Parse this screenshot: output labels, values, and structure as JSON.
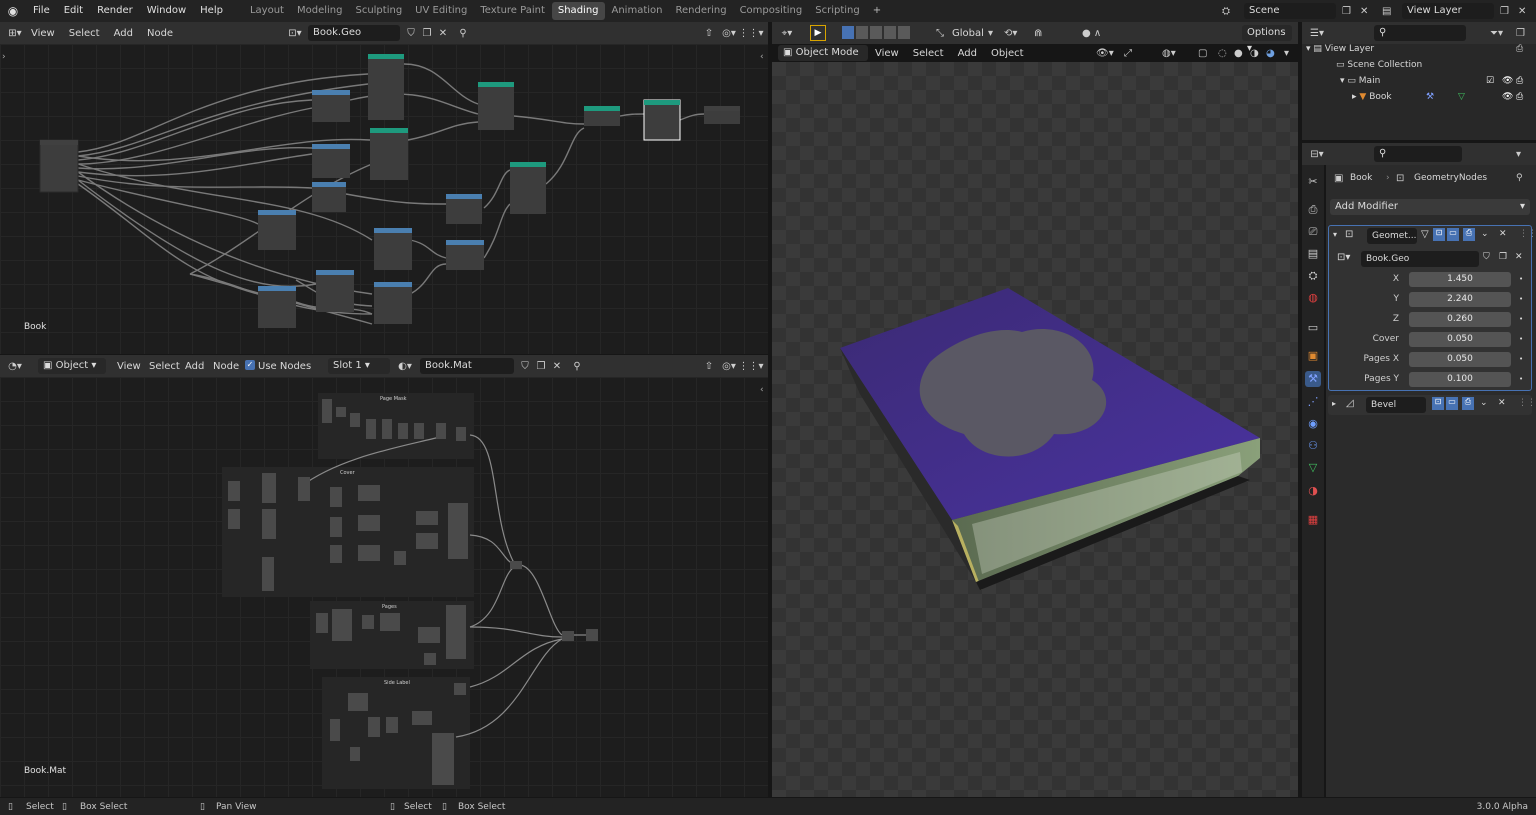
{
  "menu": {
    "items": [
      "File",
      "Edit",
      "Render",
      "Window",
      "Help"
    ]
  },
  "workspaces": [
    "Layout",
    "Modeling",
    "Sculpting",
    "UV Editing",
    "Texture Paint",
    "Shading",
    "Animation",
    "Rendering",
    "Compositing",
    "Scripting"
  ],
  "active_workspace": "Shading",
  "scene": {
    "name": "Scene",
    "view_layer": "View Layer"
  },
  "geo_editor": {
    "menus": [
      "View",
      "Select",
      "Add",
      "Node"
    ],
    "tree_name": "Book.Geo",
    "object_label": "Book"
  },
  "shader_editor": {
    "object_type": "Object",
    "menus": [
      "View",
      "Select",
      "Add",
      "Node"
    ],
    "use_nodes_label": "Use Nodes",
    "slot": "Slot 1",
    "material": "Book.Mat",
    "frames": [
      "Page Mask",
      "Cover",
      "Pages",
      "Side Label"
    ],
    "label": "Book.Mat"
  },
  "viewport": {
    "mode": "Object Mode",
    "menus": [
      "View",
      "Select",
      "Add",
      "Object"
    ],
    "transform": "Global",
    "options_label": "Options"
  },
  "outliner": {
    "view_layer": "View Layer",
    "scene_collection": "Scene Collection",
    "collection": "Main",
    "object": "Book"
  },
  "properties": {
    "object": "Book",
    "modifier_tree": "GeometryNodes",
    "add_modifier": "Add Modifier",
    "mod1_name": "Geomet...",
    "mod1_tree": "Book.Geo",
    "inputs": [
      {
        "label": "X",
        "value": "1.450"
      },
      {
        "label": "Y",
        "value": "2.240"
      },
      {
        "label": "Z",
        "value": "0.260"
      },
      {
        "label": "Cover",
        "value": "0.050"
      },
      {
        "label": "Pages X",
        "value": "0.050"
      },
      {
        "label": "Pages Y",
        "value": "0.100"
      }
    ],
    "mod2_name": "Bevel"
  },
  "status": {
    "select": "Select",
    "box_select": "Box Select",
    "pan_view": "Pan View",
    "select2": "Select",
    "box_select2": "Box Select",
    "version": "3.0.0 Alpha"
  },
  "colors": {
    "accent": "#4772b3",
    "geo_node": "#1e9a7e",
    "input_node": "#4a7fb0",
    "selected": "#ffffff"
  }
}
